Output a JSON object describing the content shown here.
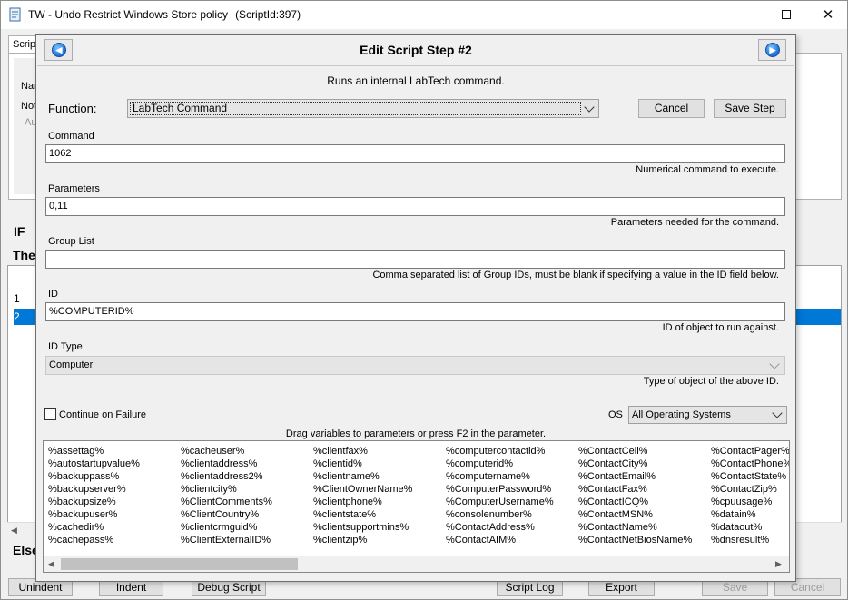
{
  "outer_window": {
    "title": "TW - Undo Restrict Windows Store policy",
    "script_id": "(ScriptId:397)",
    "tab_label": "Script",
    "labels": [
      "Nar",
      "Not",
      "Au"
    ],
    "if_label": "IF",
    "then_label": "The",
    "else_label": "Else",
    "rows": [
      "1",
      "2"
    ],
    "buttons": {
      "unindent": "Unindent",
      "indent": "Indent",
      "debug": "Debug Script",
      "script_log": "Script Log",
      "export": "Export",
      "save": "Save",
      "cancel": "Cancel"
    }
  },
  "dialog": {
    "title": "Edit Script Step #2",
    "description": "Runs an internal LabTech command.",
    "function_label": "Function:",
    "function_value": "LabTech Command",
    "cancel_label": "Cancel",
    "save_step_label": "Save Step",
    "fields": [
      {
        "label": "Command",
        "value": "1062",
        "help": "Numerical command to execute."
      },
      {
        "label": "Parameters",
        "value": "0,11",
        "help": "Parameters needed for the command."
      },
      {
        "label": "Group List",
        "value": "",
        "help": "Comma separated list of Group IDs, must be blank if specifying a value in the ID field below."
      },
      {
        "label": "ID",
        "value": "%COMPUTERID%",
        "help": "ID of object to run against."
      }
    ],
    "id_type": {
      "label": "ID Type",
      "value": "Computer",
      "help": "Type of object of the above ID."
    },
    "continue_on_failure": "Continue on Failure",
    "os_label": "OS",
    "os_value": "All Operating Systems",
    "drag_hint": "Drag variables to parameters or press F2 in the parameter.",
    "variable_columns": [
      [
        "%assettag%",
        "%autostartupvalue%",
        "%backuppass%",
        "%backupserver%",
        "%backupsize%",
        "%backupuser%",
        "%cachedir%",
        "%cachepass%"
      ],
      [
        "%cacheuser%",
        "%clientaddress%",
        "%clientaddress2%",
        "%clientcity%",
        "%ClientComments%",
        "%ClientCountry%",
        "%clientcrmguid%",
        "%ClientExternalID%"
      ],
      [
        "%clientfax%",
        "%clientid%",
        "%clientname%",
        "%ClientOwnerName%",
        "%clientphone%",
        "%clientstate%",
        "%clientsupportmins%",
        "%clientzip%"
      ],
      [
        "%computercontactid%",
        "%computerid%",
        "%computername%",
        "%ComputerPassword%",
        "%ComputerUsername%",
        "%consolenumber%",
        "%ContactAddress%",
        "%ContactAIM%"
      ],
      [
        "%ContactCell%",
        "%ContactCity%",
        "%ContactEmail%",
        "%ContactFax%",
        "%ContactICQ%",
        "%ContactMSN%",
        "%ContactName%",
        "%ContactNetBiosName%"
      ],
      [
        "%ContactPager%",
        "%ContactPhone%",
        "%ContactState%",
        "%ContactZip%",
        "%cpuusage%",
        "%datain%",
        "%dataout%",
        "%dnsresult%"
      ]
    ]
  }
}
